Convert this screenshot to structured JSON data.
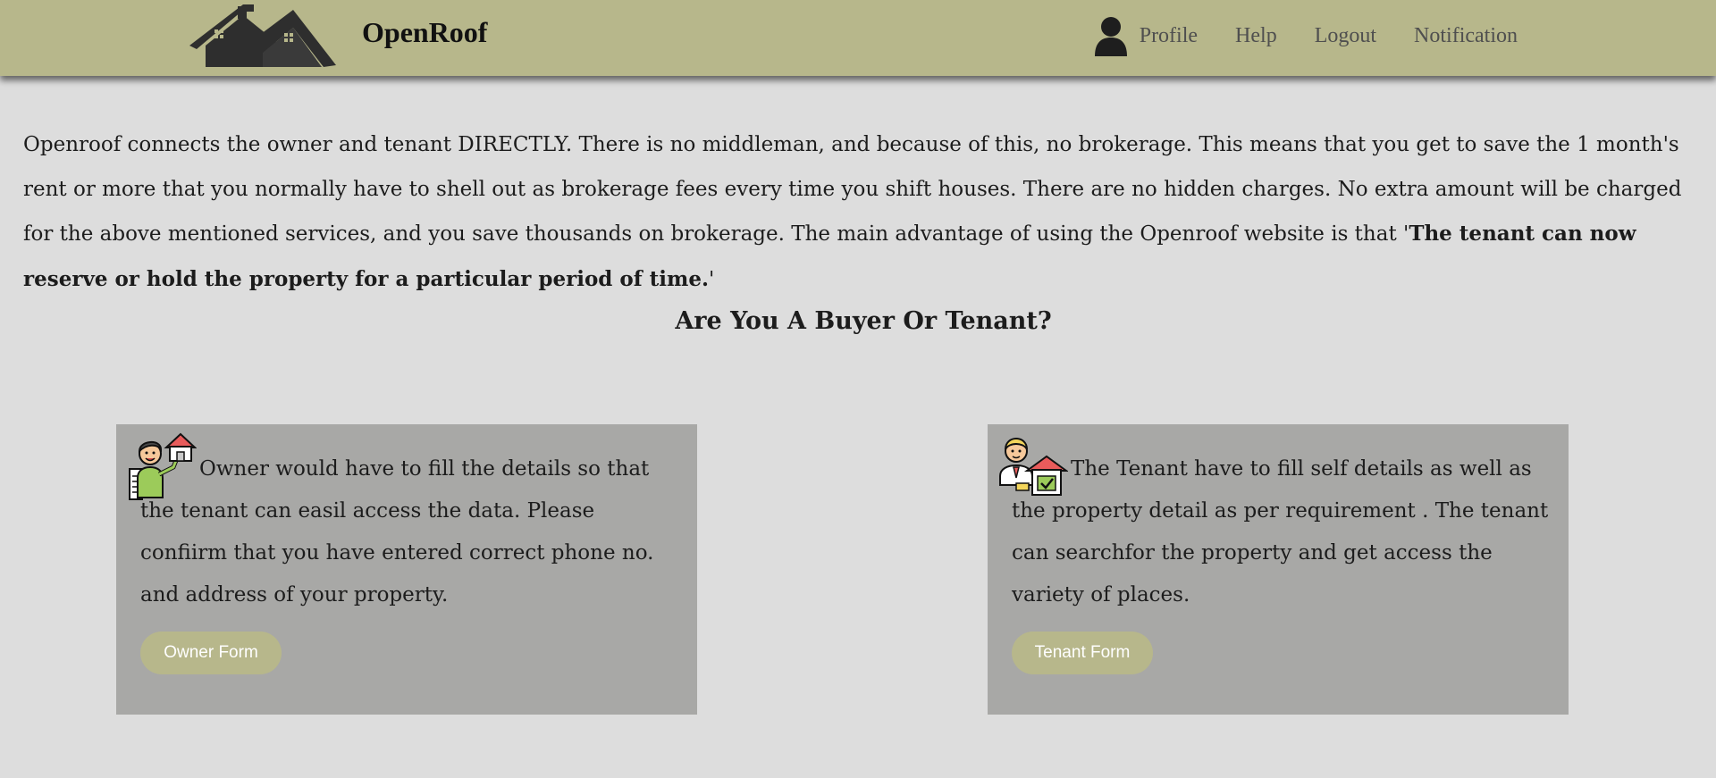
{
  "navbar": {
    "brand": "OpenRoof",
    "links": [
      "Profile",
      "Help",
      "Logout",
      "Notification"
    ],
    "logo_icon": "house-roof-icon",
    "profile_icon": "user-icon",
    "background_color": "#b7b78b"
  },
  "intro": {
    "text": "Openroof connects the owner and tenant DIRECTLY. There is no middleman, and because of this, no brokerage. This means that you get to save the 1 month's rent or more that you normally have to shell out as brokerage fees every time you shift houses. There are no hidden charges. No extra amount will be charged for the above mentioned services, and you save thousands on brokerage. The main advantage of using the Openroof website is that '",
    "bold": "The tenant can now reserve or hold the property for a particular period of time.",
    "closing": "'"
  },
  "heading": "Are You A Buyer Or Tenant?",
  "cards": {
    "owner": {
      "icon": "owner-with-house-icon",
      "text": "Owner would have to fill the details so that the tenant can easil access the data. Please confiirm that you have entered correct phone no. and address of your property.",
      "button": "Owner Form"
    },
    "tenant": {
      "icon": "tenant-with-house-check-icon",
      "text": "The Tenant have to fill self details as well as the property detail as per requirement . The tenant can searchfor the property and get access the variety of places.",
      "button": "Tenant Form"
    }
  },
  "colors": {
    "accent": "#b7b78b",
    "card": "#a8a8a6",
    "page": "#dddddd"
  }
}
